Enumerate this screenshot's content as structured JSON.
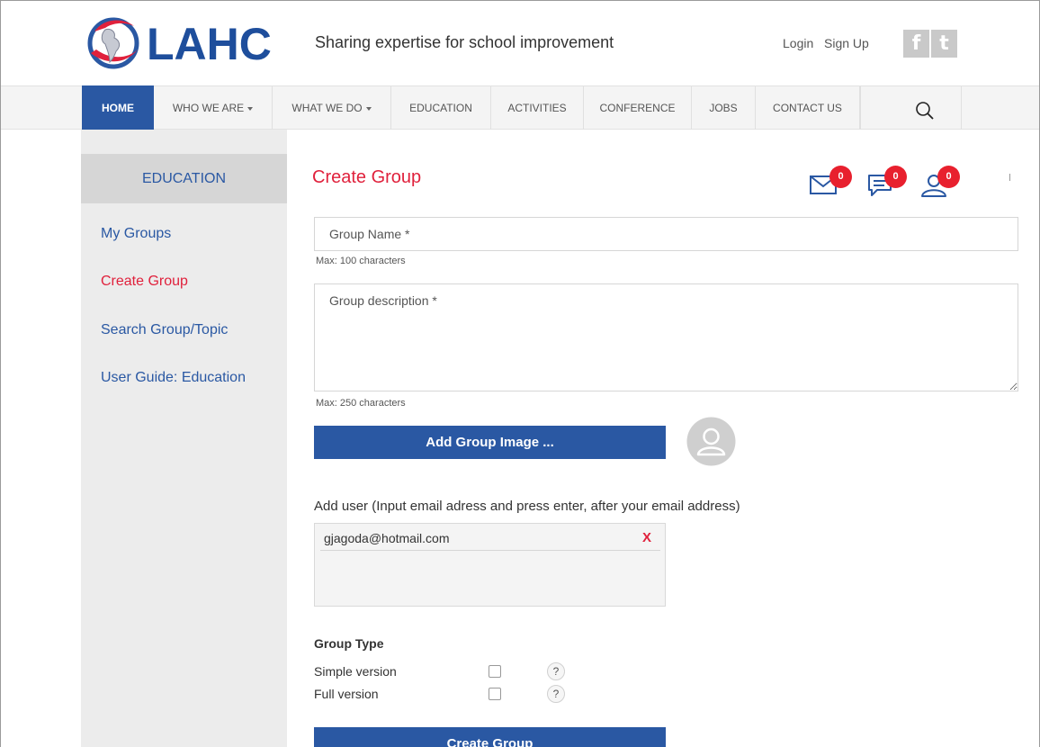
{
  "header": {
    "brand": "LAHC",
    "tagline": "Sharing expertise for school improvement",
    "login_label": "Login",
    "signup_label": "Sign Up",
    "social": {
      "facebook_glyph": "f",
      "twitter_glyph": "t"
    }
  },
  "nav": {
    "items": [
      {
        "label": "HOME",
        "active": true
      },
      {
        "label": "WHO WE ARE",
        "dropdown": true
      },
      {
        "label": "WHAT WE DO",
        "dropdown": true
      },
      {
        "label": "EDUCATION"
      },
      {
        "label": "ACTIVITIES"
      },
      {
        "label": "CONFERENCE"
      },
      {
        "label": "JOBS"
      },
      {
        "label": "CONTACT US"
      }
    ],
    "search_icon": "search-icon"
  },
  "sidebar": {
    "heading": "EDUCATION",
    "links": [
      {
        "label": "My Groups"
      },
      {
        "label": "Create Group",
        "current": true
      },
      {
        "label": "Search Group/Topic"
      },
      {
        "label": "User Guide: Education"
      }
    ]
  },
  "main": {
    "title": "Create Group",
    "notifications": {
      "messages": {
        "icon": "envelope-icon",
        "count": "0"
      },
      "chat": {
        "icon": "chat-icon",
        "count": "0"
      },
      "requests": {
        "icon": "user-icon",
        "count": "0"
      }
    },
    "form": {
      "group_name": {
        "placeholder": "Group Name *",
        "value": "",
        "hint": "Max: 100 characters"
      },
      "group_description": {
        "placeholder": "Group description *",
        "value": "",
        "hint": "Max: 250 characters"
      },
      "add_image_label": "Add Group Image ...",
      "add_user_label": "Add user (Input email adress and press enter, after your email address)",
      "users": [
        {
          "email": "gjagoda@hotmail.com",
          "remove": "X"
        }
      ],
      "group_type": {
        "label": "Group Type",
        "options": [
          {
            "label": "Simple version",
            "checked": false,
            "help": "?"
          },
          {
            "label": "Full version",
            "checked": false,
            "help": "?"
          }
        ]
      },
      "submit_label": "Create Group"
    }
  },
  "colors": {
    "brand_blue": "#2a58a3",
    "accent_red": "#e0213c",
    "badge_red": "#e8202e",
    "sidebar_bg": "#ececec"
  }
}
